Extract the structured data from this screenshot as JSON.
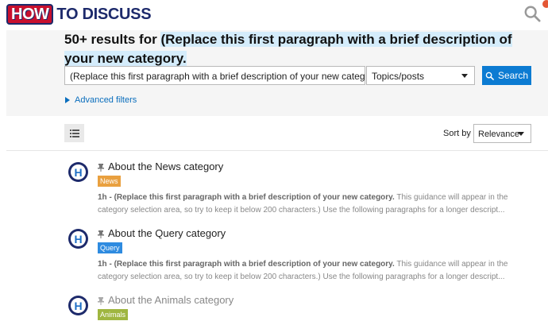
{
  "header": {
    "logo_part1": "HOW",
    "logo_part2": "TO DISCUSS"
  },
  "search": {
    "results_prefix": "50+ results for",
    "query_quoted": "(Replace this first paragraph with a brief description of your new category.",
    "input_value": "(Replace this first paragraph with a brief description of your new category.",
    "type_value": "Topics/posts",
    "button_label": "Search",
    "advanced_filters": "Advanced filters"
  },
  "sort": {
    "label": "Sort by",
    "value": "Relevance"
  },
  "results": [
    {
      "title": "About the News category",
      "category": "News",
      "category_color": "#e9a03f",
      "time": "1h",
      "bold": "(Replace this first paragraph with a brief description of your new category.",
      "rest": "This guidance will appear in the category selection area, so try to keep it below 200 characters.) Use the following paragraphs for a longer descript..."
    },
    {
      "title": "About the Query category",
      "category": "Query",
      "category_color": "#2e8be0",
      "time": "1h",
      "bold": "(Replace this first paragraph with a brief description of your new category.",
      "rest": "This guidance will appear in the category selection area, so try to keep it below 200 characters.) Use the following paragraphs for a longer descript..."
    },
    {
      "title": "About the Animals category",
      "category": "Animals",
      "category_color": "#9fb640"
    }
  ],
  "colors": {
    "accent": "#0c7bd2",
    "brand_red": "#c8102e",
    "brand_navy": "#1d2a6b"
  }
}
